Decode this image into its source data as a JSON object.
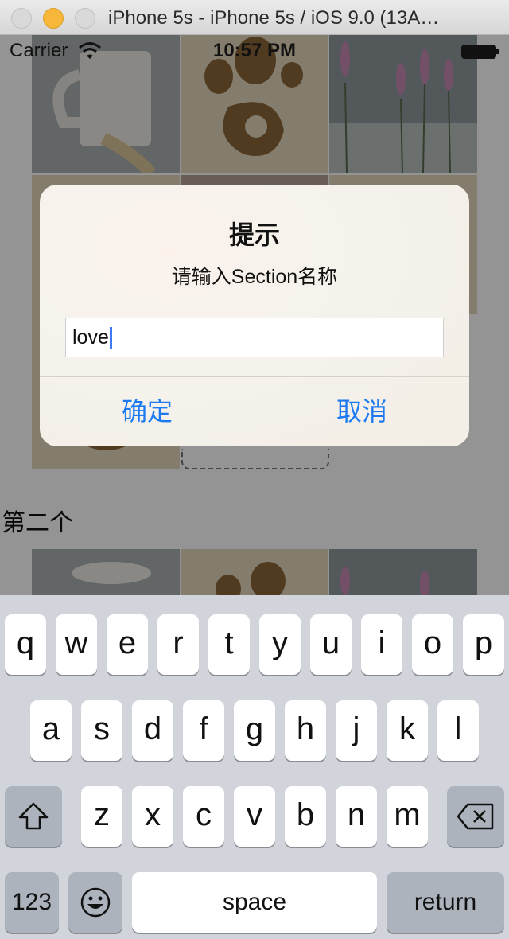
{
  "window": {
    "title": "iPhone 5s - iPhone 5s / iOS 9.0 (13A…"
  },
  "status_bar": {
    "carrier": "Carrier",
    "time": "10:57 PM"
  },
  "content": {
    "section_title": "第二个"
  },
  "alert": {
    "title": "提示",
    "message": "请输入Section名称",
    "input_value": "love",
    "confirm_label": "确定",
    "cancel_label": "取消",
    "button_color": "#1b7af2"
  },
  "keyboard": {
    "row1": [
      "q",
      "w",
      "e",
      "r",
      "t",
      "y",
      "u",
      "i",
      "o",
      "p"
    ],
    "row2": [
      "a",
      "s",
      "d",
      "f",
      "g",
      "h",
      "j",
      "k",
      "l"
    ],
    "row3": [
      "z",
      "x",
      "c",
      "v",
      "b",
      "n",
      "m"
    ],
    "numbers_label": "123",
    "space_label": "space",
    "return_label": "return",
    "icons": [
      "shift-icon",
      "delete-icon",
      "emoji-icon"
    ]
  }
}
